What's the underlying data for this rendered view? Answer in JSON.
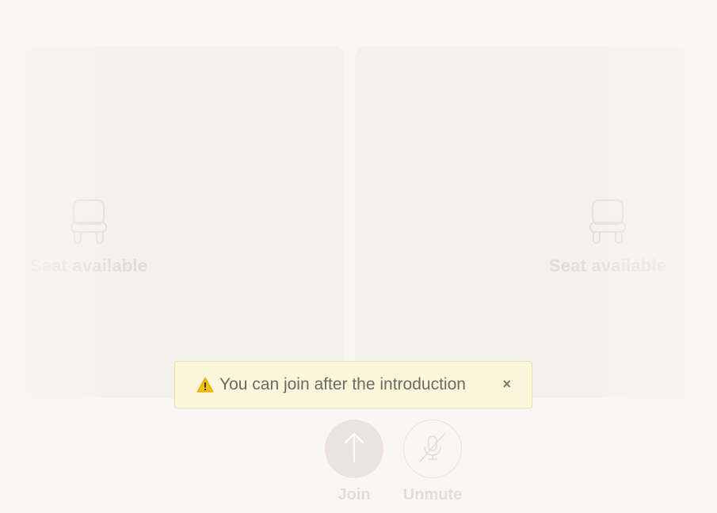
{
  "seats": [
    {
      "label": "Seat available",
      "icon": "chair-icon"
    },
    {
      "label": "Seat available",
      "icon": "chair-icon"
    }
  ],
  "toast": {
    "icon": "warning-icon",
    "message": "You can join after the introduction",
    "close_label": "×"
  },
  "controls": {
    "join": {
      "label": "Join",
      "icon": "arrow-up-icon"
    },
    "unmute": {
      "label": "Unmute",
      "icon": "microphone-muted-icon"
    }
  },
  "colors": {
    "background": "#f8f7f4",
    "card": "#f3f1ed",
    "muted_text": "#e4dbd2",
    "toast_bg": "#fbf6dc",
    "toast_border": "#ece3a8",
    "warning": "#f2c200"
  }
}
